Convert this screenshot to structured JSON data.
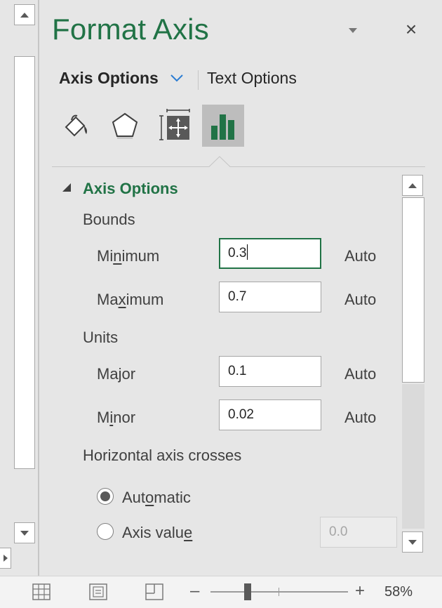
{
  "pane": {
    "title": "Format Axis",
    "dropdown_icon": "chevron-down-icon",
    "close_label": "×"
  },
  "option_tabs": {
    "axis_options": "Axis Options",
    "text_options": "Text Options"
  },
  "icon_tabs": [
    {
      "name": "fill-line",
      "icon": "paint-bucket-icon",
      "selected": false
    },
    {
      "name": "effects",
      "icon": "pentagon-icon",
      "selected": false
    },
    {
      "name": "size-properties",
      "icon": "size-properties-icon",
      "selected": false
    },
    {
      "name": "axis-options",
      "icon": "bar-chart-icon",
      "selected": true
    }
  ],
  "section": {
    "title": "Axis Options",
    "bounds_label": "Bounds",
    "minimum": {
      "label_pre": "Mi",
      "label_u": "n",
      "label_post": "imum",
      "value": "0.3",
      "auto": "Auto"
    },
    "maximum": {
      "label_pre": "Ma",
      "label_u": "x",
      "label_post": "imum",
      "value": "0.7",
      "auto": "Auto"
    },
    "units_label": "Units",
    "major": {
      "label_pre": "Ma",
      "label_u": "j",
      "label_post": "or",
      "value": "0.1",
      "auto": "Auto"
    },
    "minor": {
      "label_pre": "M",
      "label_u": "i",
      "label_post": "nor",
      "value": "0.02",
      "auto": "Auto"
    },
    "crosses_label": "Horizontal axis crosses",
    "automatic": {
      "label_pre": "Aut",
      "label_u": "o",
      "label_post": "matic",
      "selected": true
    },
    "axis_value": {
      "label_pre": "Axis valu",
      "label_u": "e",
      "label_post": "",
      "selected": false,
      "value": "0.0"
    }
  },
  "status_bar": {
    "zoom_minus": "–",
    "zoom_plus": "+",
    "zoom_level": "58%",
    "zoom_percent": 58
  },
  "colors": {
    "accent": "#217346",
    "selected_tab": "#bdbdbd",
    "pane_background": "#e6e6e6"
  }
}
